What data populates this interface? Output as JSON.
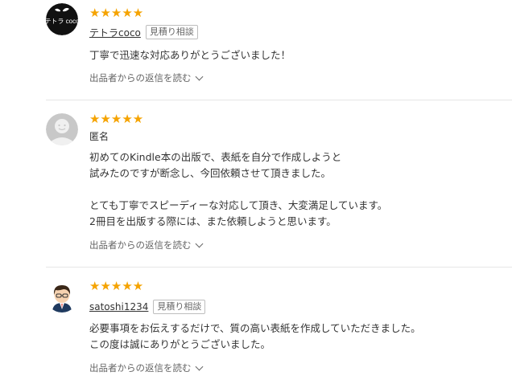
{
  "reviews": [
    {
      "stars": "★★★★★",
      "rating": 5,
      "avatar": {
        "label": "テトラ coco"
      },
      "username": "テトラcoco",
      "badge": "見積り相談",
      "comment": "丁寧で迅速な対応ありがとうございました！",
      "reply_link": "出品者からの返信を読む"
    },
    {
      "stars": "★★★★★",
      "rating": 5,
      "username": "匿名",
      "comment": "初めてのKindle本の出版で、表紙を自分で作成しようと\n試みたのですが断念し、今回依頼させて頂きました。\n\nとても丁寧でスピーディーな対応して頂き、大変満足しています。\n2冊目を出版する際には、また依頼しようと思います。",
      "reply_link": "出品者からの返信を読む"
    },
    {
      "stars": "★★★★★",
      "rating": 5,
      "username": "satoshi1234",
      "badge": "見積り相談",
      "comment": "必要事項をお伝えするだけで、質の高い表紙を作成していただきました。\nこの度は誠にありがとうございました。",
      "reply_link": "出品者からの返信を読む"
    }
  ],
  "colors": {
    "star": "#f5a300",
    "text": "#333333",
    "muted": "#666666",
    "divider": "#e6e6e6"
  }
}
